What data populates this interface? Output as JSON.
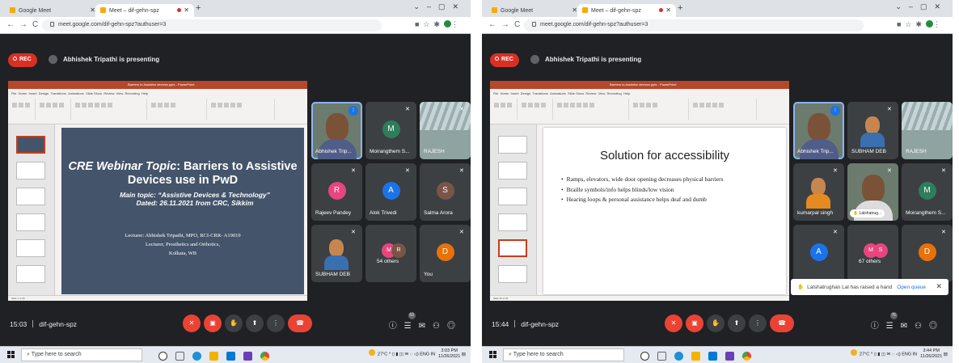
{
  "left": {
    "browser": {
      "tab1_title": "Google Meet",
      "tab2_title": "Meet – dif-gehn-spz",
      "url": "meet.google.com/dif-gehn-spz?authuser=3"
    },
    "meet": {
      "rec_label": "REC",
      "presenting_text": "Abhishek Tripathi is presenting",
      "time": "15:03",
      "meeting_code": "dif-gehn-spz",
      "participant_count_badge": "63"
    },
    "slide": {
      "title_prefix": "CRE Webinar Topic",
      "title_rest": ": Barriers to Assistive Devices use in PwD",
      "main_topic_label": "Main topic",
      "main_topic": ": “Assistive Devices & Technology”",
      "dated_label": "Dated",
      "dated": ": 26.11.2021 from CRC, Sikkim",
      "lecturer_line1": "Lecturer: Abhishek Tripathi, MPO, RCI-CRR- A19019",
      "lecturer_line2": "Lecturer, Prosthetics and Orthotics,",
      "lecturer_line3": "Kolkata, WB"
    },
    "tiles": [
      {
        "name": "Abhishek Trip..."
      },
      {
        "name": "Moirangthem S...",
        "initial": "M"
      },
      {
        "name": "RAJESH"
      },
      {
        "name": "Rajeev Pandey",
        "initial": "R"
      },
      {
        "name": "Alok Trivedi",
        "initial": "A"
      },
      {
        "name": "Salma Arora",
        "initial": "S"
      },
      {
        "name": "SUBHAM DEB"
      },
      {
        "name": "54 others",
        "initial_a": "M",
        "initial_b": "R"
      },
      {
        "name": "You",
        "initial": "D"
      }
    ],
    "taskbar": {
      "search_placeholder": "Type here to search",
      "temp": "27°C",
      "lang": "ENG",
      "lang_sub": "IN",
      "clock_time": "3:03 PM",
      "clock_date": "11/26/2021"
    }
  },
  "right": {
    "browser": {
      "tab1_title": "Google Meet",
      "tab2_title": "Meet – dif-gehn-spz",
      "url": "meet.google.com/dif-gehn-spz?authuser=3"
    },
    "meet": {
      "rec_label": "REC",
      "presenting_text": "Abhishek Tripathi is presenting",
      "time": "15:44",
      "meeting_code": "dif-gehn-spz",
      "participant_count_badge": "76"
    },
    "slide": {
      "title": "Solution for accessibility",
      "bullets": [
        "Ramps, elevators, wide door opening decreases physical barriers",
        "Braille symbols/info helps blinds/low vision",
        "Hearing loops & personal assistance helps deaf and dumb"
      ]
    },
    "tiles": [
      {
        "name": "Abhishek Trip..."
      },
      {
        "name": "SUBHAM DEB"
      },
      {
        "name": "RAJESH"
      },
      {
        "name": "kumarpal singh"
      },
      {
        "name": "Lalshatrug..."
      },
      {
        "name": "Moirangthem S...",
        "initial": "M"
      },
      {
        "name": "",
        "initial": "A"
      },
      {
        "name": "67 others",
        "initial_a": "M",
        "initial_b": "S"
      },
      {
        "name": "",
        "initial": "D"
      }
    ],
    "notification": {
      "text": "Lalshatrughan Lal has raised a hand",
      "action": "Open queue"
    },
    "taskbar": {
      "search_placeholder": "Type here to search",
      "temp": "27°C",
      "lang": "ENG",
      "lang_sub": "IN",
      "clock_time": "3:44 PM",
      "clock_date": "11/26/2021"
    }
  },
  "colors": {
    "meet_bg": "#202124",
    "tile_bg": "#3c4043",
    "rec_red": "#d93025",
    "slide_dark": "#44546a",
    "powerpoint_orange": "#b7472a"
  }
}
